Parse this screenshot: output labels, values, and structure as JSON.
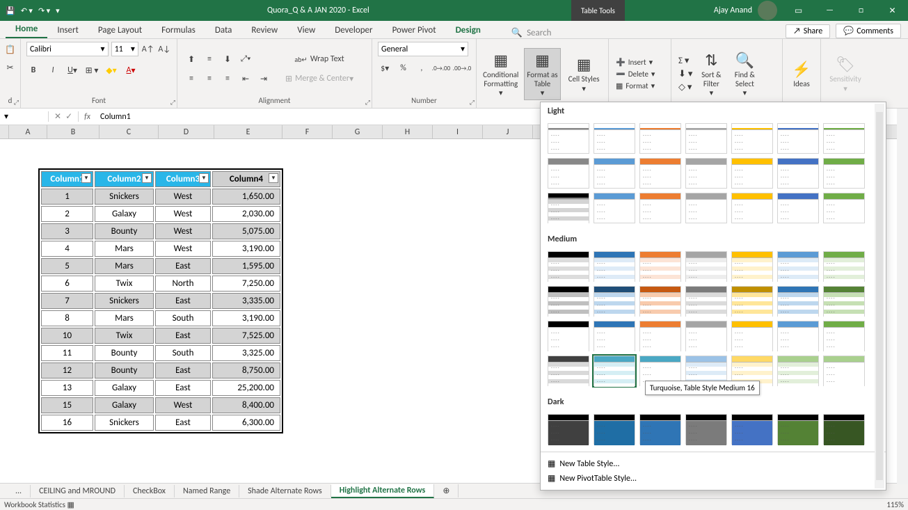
{
  "titlebar": {
    "title": "Quora_Q & A JAN 2020  -  Excel",
    "tabletools": "Table Tools",
    "user": "Ajay Anand"
  },
  "tabs": {
    "items": [
      "Home",
      "Insert",
      "Page Layout",
      "Formulas",
      "Data",
      "Review",
      "View",
      "Developer",
      "Power Pivot",
      "Design"
    ],
    "share": "Share",
    "comments": "Comments",
    "search_placeholder": "Search"
  },
  "ribbon": {
    "font": {
      "label": "Font",
      "name": "Calibri",
      "size": "11"
    },
    "alignment": {
      "label": "Alignment",
      "wrap": "Wrap Text",
      "merge": "Merge & Center"
    },
    "number": {
      "label": "Number",
      "format": "General"
    },
    "styles": {
      "conditional": "Conditional Formatting",
      "formatas": "Format as Table",
      "cellstyles": "Cell Styles"
    },
    "cells": {
      "insert": "Insert",
      "delete": "Delete",
      "format": "Format"
    },
    "editing": {
      "sort": "Sort & Filter",
      "find": "Find & Select"
    },
    "ideas": "Ideas",
    "sensitivity": "Sensitivity"
  },
  "formulabar": {
    "cell": "",
    "value": "Column1",
    "fx": "fx"
  },
  "columns": [
    "A",
    "B",
    "C",
    "D",
    "E",
    "F",
    "G",
    "H",
    "I",
    "J"
  ],
  "table": {
    "headers": [
      "Column1",
      "Column2",
      "Column3",
      "Column4"
    ],
    "rows": [
      {
        "id": "1",
        "prod": "Snickers",
        "reg": "West",
        "val": "1,650.00"
      },
      {
        "id": "2",
        "prod": "Galaxy",
        "reg": "West",
        "val": "2,030.00"
      },
      {
        "id": "3",
        "prod": "Bounty",
        "reg": "West",
        "val": "5,075.00"
      },
      {
        "id": "4",
        "prod": "Mars",
        "reg": "West",
        "val": "3,190.00"
      },
      {
        "id": "5",
        "prod": "Mars",
        "reg": "East",
        "val": "1,595.00"
      },
      {
        "id": "6",
        "prod": "Twix",
        "reg": "North",
        "val": "7,250.00"
      },
      {
        "id": "7",
        "prod": "Snickers",
        "reg": "East",
        "val": "3,335.00"
      },
      {
        "id": "8",
        "prod": "Mars",
        "reg": "South",
        "val": "3,190.00"
      },
      {
        "id": "10",
        "prod": "Twix",
        "reg": "East",
        "val": "7,525.00"
      },
      {
        "id": "11",
        "prod": "Bounty",
        "reg": "South",
        "val": "3,325.00"
      },
      {
        "id": "12",
        "prod": "Bounty",
        "reg": "East",
        "val": "8,750.00"
      },
      {
        "id": "13",
        "prod": "Galaxy",
        "reg": "East",
        "val": "25,200.00"
      },
      {
        "id": "15",
        "prod": "Galaxy",
        "reg": "West",
        "val": "8,400.00"
      },
      {
        "id": "16",
        "prod": "Snickers",
        "reg": "East",
        "val": "6,300.00"
      }
    ]
  },
  "gallery": {
    "light": "Light",
    "medium": "Medium",
    "dark": "Dark",
    "tooltip": "Turquoise, Table Style Medium 16",
    "new_table": "New Table Style...",
    "new_pivot": "New PivotTable Style..."
  },
  "sheets": {
    "more": "...",
    "items": [
      "CEILING and MROUND",
      "CheckBox",
      "Named Range",
      "Shade Alternate Rows",
      "Highlight Alternate Rows"
    ]
  },
  "statusbar": {
    "left": "Workbook Statistics",
    "zoom": "115%"
  },
  "style_colors": {
    "light_headers": [
      "#555",
      "#4aa3df",
      "#e88a3c",
      "#888",
      "#f2c430",
      "#5f9ed1",
      "#6ab04c",
      "#6ab04c"
    ],
    "medium": [
      {
        "hdr": "#000",
        "band": "#dcdcdc"
      },
      {
        "hdr": "#2e75b6",
        "band": "#deebf7"
      },
      {
        "hdr": "#ed7d31",
        "band": "#fce4d6"
      },
      {
        "hdr": "#a5a5a5",
        "band": "#ededed"
      },
      {
        "hdr": "#ffc000",
        "band": "#fff2cc"
      },
      {
        "hdr": "#5b9bd5",
        "band": "#ddebf7"
      },
      {
        "hdr": "#70ad47",
        "band": "#e2efda"
      },
      {
        "hdr": "#000",
        "band": "#bfbfbf"
      },
      {
        "hdr": "#1f4e78",
        "band": "#bdd7ee"
      },
      {
        "hdr": "#c65911",
        "band": "#f8cbad"
      },
      {
        "hdr": "#7b7b7b",
        "band": "#dbdbdb"
      },
      {
        "hdr": "#bf8f00",
        "band": "#ffe699"
      },
      {
        "hdr": "#2f75b5",
        "band": "#bdd7ee"
      },
      {
        "hdr": "#548235",
        "band": "#c6e0b4"
      },
      {
        "hdr": "#000",
        "band": "#fff"
      },
      {
        "hdr": "#2e75b6",
        "band": "#fff"
      },
      {
        "hdr": "#ed7d31",
        "band": "#fff"
      },
      {
        "hdr": "#a5a5a5",
        "band": "#fff"
      },
      {
        "hdr": "#ffc000",
        "band": "#fff"
      },
      {
        "hdr": "#5b9bd5",
        "band": "#fff"
      },
      {
        "hdr": "#70ad47",
        "band": "#fff"
      },
      {
        "hdr": "#404040",
        "band": "#d9d9d9"
      },
      {
        "hdr": "#4aa8c4",
        "band": "#d5eef4"
      },
      {
        "hdr": "#4aa8c4",
        "band": "#fff"
      },
      {
        "hdr": "#9bc2e6",
        "band": "#ddebf7"
      },
      {
        "hdr": "#ffd966",
        "band": "#fff2cc"
      },
      {
        "hdr": "#a9d08e",
        "band": "#e2efda"
      },
      {
        "hdr": "#a9d08e",
        "band": "#fff"
      }
    ],
    "dark": [
      {
        "hdr": "#000",
        "body": "#404040"
      },
      {
        "hdr": "#000",
        "body": "#1f6ea5"
      },
      {
        "hdr": "#000",
        "body": "#2f75b5"
      },
      {
        "hdr": "#000",
        "body": "#7b7b7b"
      },
      {
        "hdr": "#000",
        "body": "#4472c4"
      },
      {
        "hdr": "#000",
        "body": "#548235"
      },
      {
        "hdr": "#000",
        "body": "#375623"
      }
    ]
  }
}
